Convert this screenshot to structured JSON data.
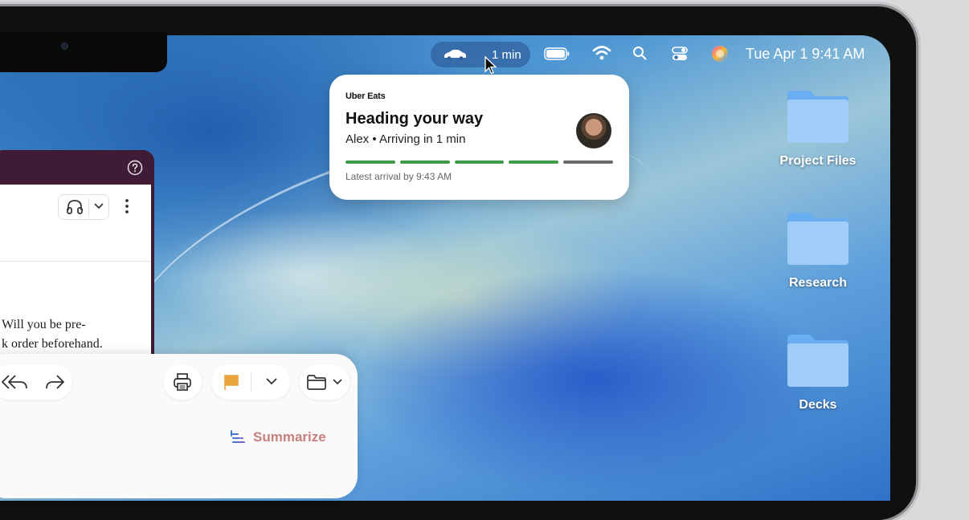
{
  "menubar": {
    "live_activity_time": "1 min",
    "clock": "Tue Apr 1  9:41 AM",
    "icons": [
      "car-icon",
      "battery-icon",
      "wifi-icon",
      "search-icon",
      "control-center-icon",
      "siri-icon"
    ]
  },
  "notification": {
    "app": "Uber Eats",
    "title": "Heading your way",
    "subtitle": "Alex • Arriving in 1 min",
    "footer": "Latest arrival by 9:43 AM",
    "progress": {
      "segments": 5,
      "completed": 4,
      "active_color": "#3f9a4a",
      "pending_color": "#6b6b6b"
    }
  },
  "desktop": {
    "folders": [
      {
        "label": "Project Files"
      },
      {
        "label": "Research"
      },
      {
        "label": "Decks"
      }
    ]
  },
  "chat_window": {
    "message_lines": [
      "Will you be pre-",
      "k order beforehand."
    ]
  },
  "mail_toolbar": {
    "summarize_label": "Summarize",
    "flag_color": "#e8a33a"
  }
}
